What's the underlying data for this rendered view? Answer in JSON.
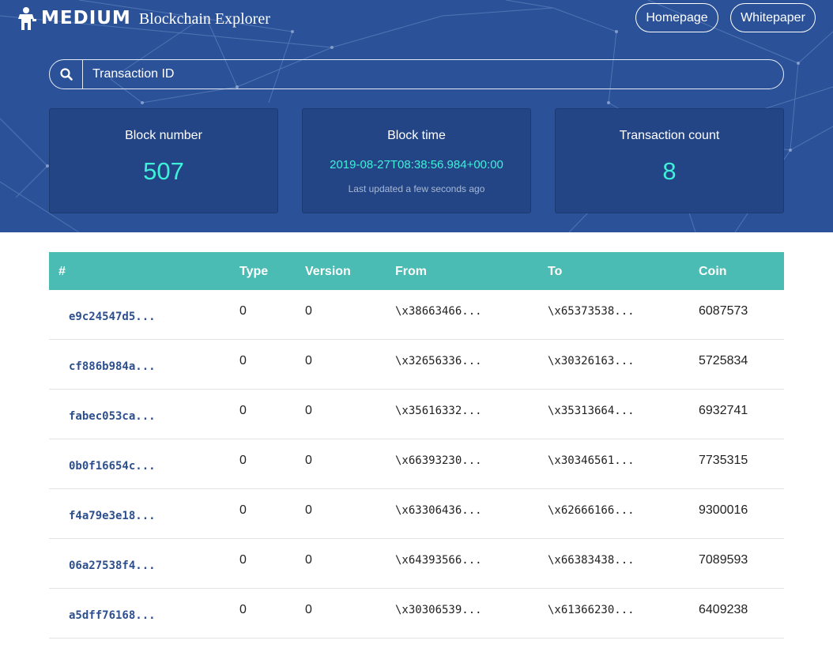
{
  "header": {
    "logo_text": "MEDIUM",
    "subtitle": "Blockchain Explorer",
    "nav": {
      "homepage": "Homepage",
      "whitepaper": "Whitepaper"
    }
  },
  "search": {
    "placeholder": "Transaction ID"
  },
  "stats": {
    "block_number": {
      "label": "Block number",
      "value": "507"
    },
    "block_time": {
      "label": "Block time",
      "value": "2019-08-27T08:38:56.984+00:00",
      "updated": "Last updated a few seconds ago"
    },
    "transaction_count": {
      "label": "Transaction count",
      "value": "8"
    }
  },
  "table": {
    "headers": {
      "hash": "#",
      "type": "Type",
      "version": "Version",
      "from": "From",
      "to": "To",
      "coin": "Coin"
    },
    "rows": [
      {
        "hash": "e9c24547d5...",
        "type": "0",
        "version": "0",
        "from": "\\x38663466...",
        "to": "\\x65373538...",
        "coin": "6087573"
      },
      {
        "hash": "cf886b984a...",
        "type": "0",
        "version": "0",
        "from": "\\x32656336...",
        "to": "\\x30326163...",
        "coin": "5725834"
      },
      {
        "hash": "fabec053ca...",
        "type": "0",
        "version": "0",
        "from": "\\x35616332...",
        "to": "\\x35313664...",
        "coin": "6932741"
      },
      {
        "hash": "0b0f16654c...",
        "type": "0",
        "version": "0",
        "from": "\\x66393230...",
        "to": "\\x30346561...",
        "coin": "7735315"
      },
      {
        "hash": "f4a79e3e18...",
        "type": "0",
        "version": "0",
        "from": "\\x63306436...",
        "to": "\\x62666166...",
        "coin": "9300016"
      },
      {
        "hash": "06a27538f4...",
        "type": "0",
        "version": "0",
        "from": "\\x64393566...",
        "to": "\\x66383438...",
        "coin": "7089593"
      },
      {
        "hash": "a5dff76168...",
        "type": "0",
        "version": "0",
        "from": "\\x30306539...",
        "to": "\\x61366230...",
        "coin": "6409238"
      }
    ]
  },
  "colors": {
    "hero": "#2b5299",
    "card": "#234585",
    "accent": "#3ff0d9",
    "table_header": "#4abcb3",
    "hash": "#2d4f8e"
  }
}
